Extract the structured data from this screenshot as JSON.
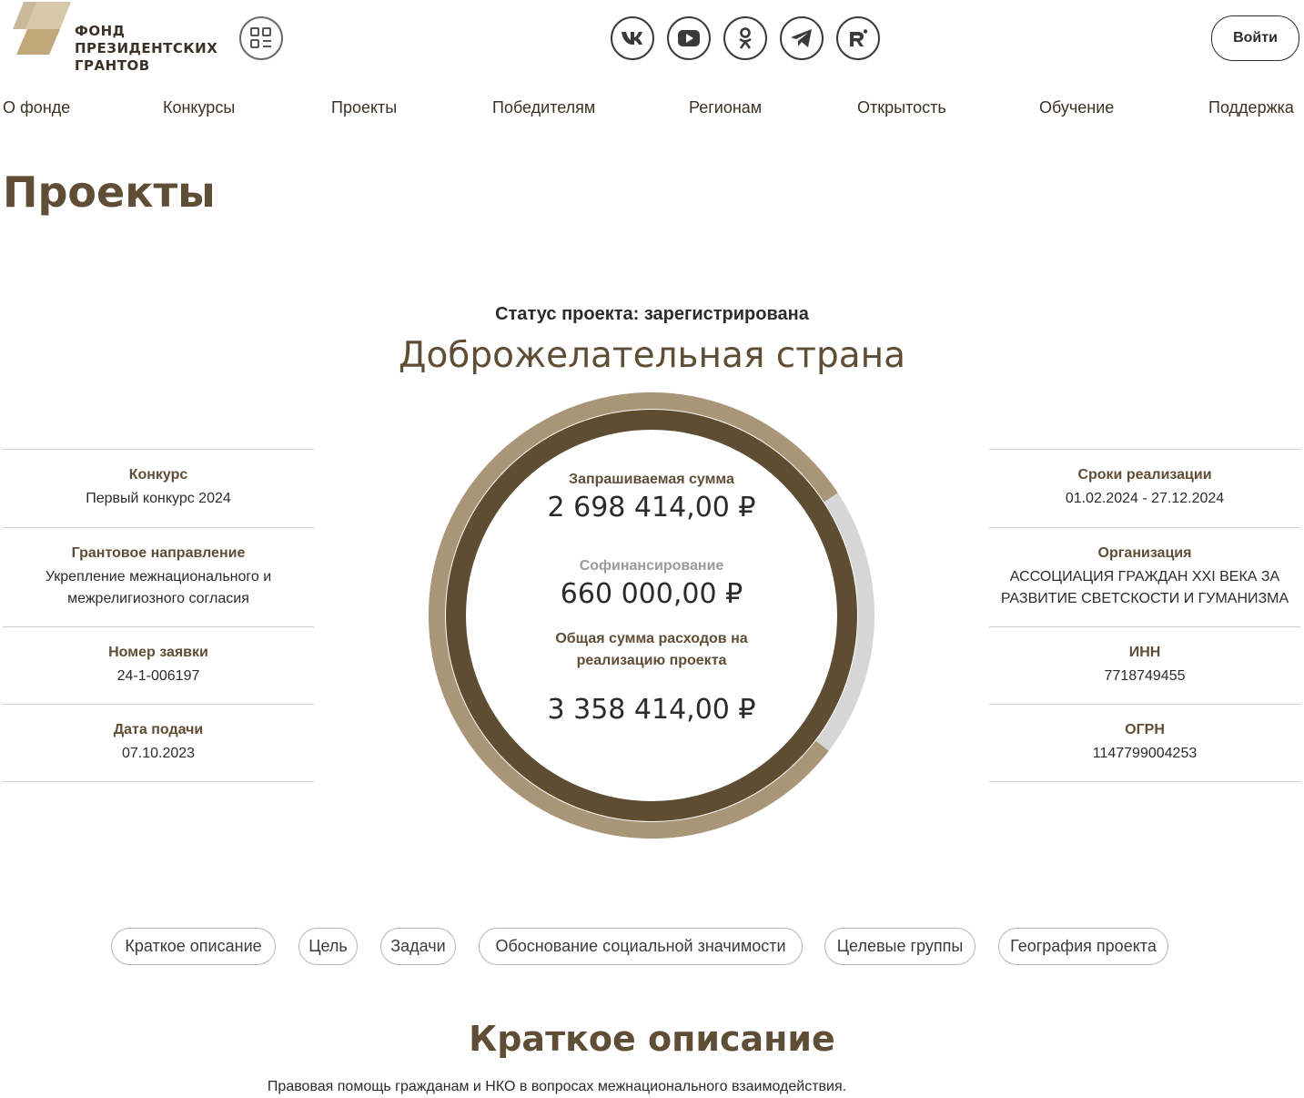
{
  "header": {
    "logo_lines": [
      "ФОНД",
      "ПРЕЗИДЕНТСКИХ",
      "ГРАНТОВ"
    ],
    "login_label": "Войти",
    "socials": [
      {
        "name": "vk-icon",
        "glyph": "vk"
      },
      {
        "name": "youtube-icon",
        "glyph": "yt"
      },
      {
        "name": "odnoklassniki-icon",
        "glyph": "ok"
      },
      {
        "name": "telegram-icon",
        "glyph": "tg"
      },
      {
        "name": "rutube-icon",
        "glyph": "R"
      }
    ]
  },
  "nav": [
    "О фонде",
    "Конкурсы",
    "Проекты",
    "Победителям",
    "Регионам",
    "Открытость",
    "Обучение",
    "Поддержка"
  ],
  "page_title": "Проекты",
  "project": {
    "status": "Статус проекта: зарегистрирована",
    "name": "Доброжелательная страна"
  },
  "left_info": [
    {
      "label": "Конкурс",
      "value": "Первый конкурс 2024"
    },
    {
      "label": "Грантовое направление",
      "value": "Укрепление межнационального и межрелигиозного согласия"
    },
    {
      "label": "Номер заявки",
      "value": "24-1-006197"
    },
    {
      "label": "Дата подачи",
      "value": "07.10.2023"
    }
  ],
  "right_info": [
    {
      "label": "Сроки реализации",
      "value": "01.02.2024 - 27.12.2024"
    },
    {
      "label": "Организация",
      "value": "АССОЦИАЦИЯ ГРАЖДАН XXI ВЕКА ЗА РАЗВИТИЕ СВЕТСКОСТИ И ГУМАНИЗМА"
    },
    {
      "label": "ИНН",
      "value": "7718749455"
    },
    {
      "label": "ОГРН",
      "value": "1147799004253"
    }
  ],
  "amounts": {
    "requested_label": "Запрашиваемая сумма",
    "requested_value": "2 698 414,00 ₽",
    "cofinancing_label": "Софинансирование",
    "cofinancing_value": "660 000,00 ₽",
    "total_label": "Общая сумма расходов на реализацию проекта",
    "total_value": "3 358 414,00 ₽"
  },
  "ring": {
    "requested_fraction": 0.8035,
    "colors": {
      "requested": "#a99578",
      "cofinancing": "#d6d6d6",
      "inner": "#5e4d33"
    }
  },
  "tabs": [
    "Краткое описание",
    "Цель",
    "Задачи",
    "Обоснование социальной значимости",
    "Целевые группы",
    "География проекта"
  ],
  "section": {
    "title": "Краткое описание",
    "text": "Правовая помощь гражданам и НКО в вопросах межнационального взаимодействия."
  }
}
